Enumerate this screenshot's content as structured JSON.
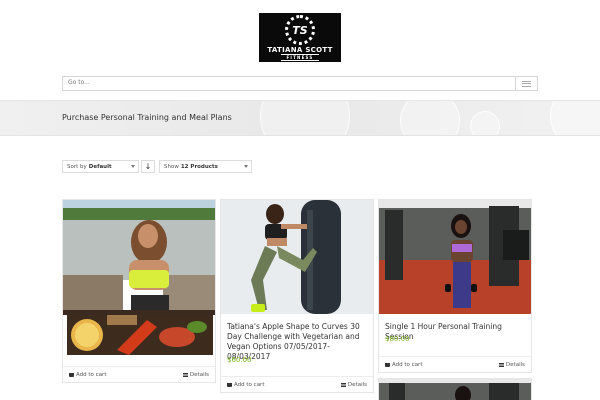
{
  "logo": {
    "initials": "TS",
    "name": "TATIANA SCOTT",
    "subtitle": "FITNESS"
  },
  "nav": {
    "placeholder": "Go to..."
  },
  "banner": {
    "title": "Purchase Personal Training and Meal Plans"
  },
  "toolbar": {
    "sort_label": "Sort by",
    "sort_value": "Default",
    "order_icon": "↓",
    "show_label": "Show",
    "show_value": "12 Products"
  },
  "products": [
    {
      "title": "",
      "price": "",
      "cart_label": "Add to cart",
      "details_label": "Details",
      "image": "woman-yellow-top-outdoors-and-meal"
    },
    {
      "title": "Tatiana's Apple Shape to Curves 30 Day Challenge with Vegetarian and Vegan Options 07/05/2017-08/03/2017",
      "price": "$60.00",
      "cart_label": "Add to cart",
      "details_label": "Details",
      "image": "woman-kicking-heavy-bag"
    },
    {
      "title": "Single 1 Hour Personal Training Session",
      "price": "$80.00",
      "cart_label": "Add to cart",
      "details_label": "Details",
      "image": "woman-with-dumbbells-in-gym"
    }
  ],
  "colors": {
    "accent": "#7ab317",
    "logo_bg": "#0a0a0a"
  }
}
